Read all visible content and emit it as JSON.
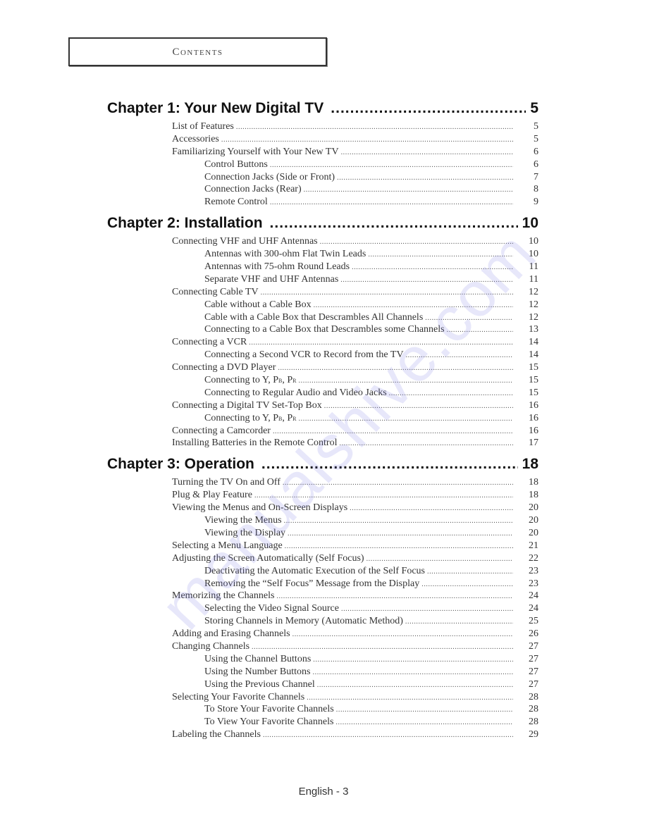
{
  "header": {
    "title": "Contents"
  },
  "chapters": [
    {
      "title": "Chapter 1: Your New Digital TV",
      "page": "5",
      "entries": [
        {
          "level": 1,
          "title": "List of Features",
          "page": "5"
        },
        {
          "level": 1,
          "title": "Accessories",
          "page": "5"
        },
        {
          "level": 1,
          "title": "Familiarizing Yourself with Your New TV",
          "page": "6"
        },
        {
          "level": 2,
          "title": "Control Buttons",
          "page": "6"
        },
        {
          "level": 2,
          "title": "Connection Jacks (Side or Front)",
          "page": "7"
        },
        {
          "level": 2,
          "title": "Connection Jacks (Rear)",
          "page": "8"
        },
        {
          "level": 2,
          "title": "Remote Control",
          "page": "9"
        }
      ]
    },
    {
      "title": "Chapter 2: Installation",
      "page": "10",
      "entries": [
        {
          "level": 1,
          "title": "Connecting VHF and UHF Antennas",
          "page": "10"
        },
        {
          "level": 2,
          "title": "Antennas with 300-ohm Flat Twin Leads",
          "page": "10"
        },
        {
          "level": 2,
          "title": "Antennas with 75-ohm Round Leads",
          "page": "11"
        },
        {
          "level": 2,
          "title": "Separate VHF and UHF Antennas",
          "page": "11"
        },
        {
          "level": 1,
          "title": "Connecting Cable TV",
          "page": "12"
        },
        {
          "level": 2,
          "title": "Cable without a Cable Box",
          "page": "12"
        },
        {
          "level": 2,
          "title": "Cable with a Cable Box that Descrambles All Channels",
          "page": "12"
        },
        {
          "level": 2,
          "title": "Connecting to a Cable Box that Descrambles some Channels",
          "page": "13"
        },
        {
          "level": 1,
          "title": "Connecting a VCR",
          "page": "14"
        },
        {
          "level": 2,
          "title": "Connecting a Second VCR to Record from the TV",
          "page": "14"
        },
        {
          "level": 1,
          "title": "Connecting a DVD Player",
          "page": "15"
        },
        {
          "level": 2,
          "title": "Connecting to Y, PB, PR",
          "page": "15"
        },
        {
          "level": 2,
          "title": "Connecting to Regular Audio and Video Jacks",
          "page": "15"
        },
        {
          "level": 1,
          "title": "Connecting a Digital TV Set-Top Box",
          "page": "16"
        },
        {
          "level": 2,
          "title": "Connecting to Y, PB, PR",
          "page": "16"
        },
        {
          "level": 1,
          "title": "Connecting a Camcorder",
          "page": "16"
        },
        {
          "level": 1,
          "title": "Installing Batteries in the Remote Control",
          "page": "17"
        }
      ]
    },
    {
      "title": "Chapter 3: Operation",
      "page": "18",
      "entries": [
        {
          "level": 1,
          "title": "Turning the TV On and Off",
          "page": "18"
        },
        {
          "level": 1,
          "title": "Plug & Play Feature",
          "page": "18"
        },
        {
          "level": 1,
          "title": "Viewing the Menus and On-Screen Displays",
          "page": "20"
        },
        {
          "level": 2,
          "title": "Viewing the Menus",
          "page": "20"
        },
        {
          "level": 2,
          "title": "Viewing the Display",
          "page": "20"
        },
        {
          "level": 1,
          "title": "Selecting a Menu Language",
          "page": "21"
        },
        {
          "level": 1,
          "title": "Adjusting the Screen Automatically (Self Focus)",
          "page": "22"
        },
        {
          "level": 2,
          "title": "Deactivating the Automatic Execution of the Self Focus",
          "page": "23"
        },
        {
          "level": 2,
          "title": "Removing the “Self Focus” Message from the Display",
          "page": "23"
        },
        {
          "level": 1,
          "title": "Memorizing the Channels",
          "page": "24"
        },
        {
          "level": 2,
          "title": "Selecting the Video Signal Source",
          "page": "24"
        },
        {
          "level": 2,
          "title": "Storing Channels in Memory (Automatic Method)",
          "page": "25"
        },
        {
          "level": 1,
          "title": "Adding and Erasing Channels",
          "page": "26"
        },
        {
          "level": 1,
          "title": "Changing Channels",
          "page": "27"
        },
        {
          "level": 2,
          "title": "Using the Channel Buttons",
          "page": "27"
        },
        {
          "level": 2,
          "title": "Using the Number Buttons",
          "page": "27"
        },
        {
          "level": 2,
          "title": "Using the Previous Channel",
          "page": "27"
        },
        {
          "level": 1,
          "title": "Selecting Your Favorite Channels",
          "page": "28"
        },
        {
          "level": 2,
          "title": "To Store Your Favorite Channels",
          "page": "28"
        },
        {
          "level": 2,
          "title": "To View Your Favorite Channels",
          "page": "28"
        },
        {
          "level": 1,
          "title": "Labeling the Channels",
          "page": "29"
        }
      ]
    }
  ],
  "footer": {
    "page_label": "English - 3"
  },
  "watermark": {
    "text": "manualshive.com",
    "color": "#7878e6"
  }
}
